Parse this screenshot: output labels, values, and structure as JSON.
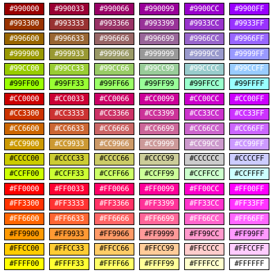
{
  "swatches": [
    [
      "#990000",
      "#990033",
      "#990066",
      "#990099",
      "#9900CC",
      "#9900FF"
    ],
    [
      "#993300",
      "#993333",
      "#993366",
      "#993399",
      "#9933CC",
      "#9933FF"
    ],
    [
      "#996600",
      "#996633",
      "#996666",
      "#996699",
      "#9966CC",
      "#9966FF"
    ],
    [
      "#999900",
      "#999933",
      "#999966",
      "#999999",
      "#9999CC",
      "#9999FF"
    ],
    [
      "#99CC00",
      "#99CC33",
      "#99CC66",
      "#99CC99",
      "#99CCCC",
      "#99CCFF"
    ],
    [
      "#99FF00",
      "#99FF33",
      "#99FF66",
      "#99FF99",
      "#99FFCC",
      "#99FFFF"
    ],
    [
      "#CC0000",
      "#CC0033",
      "#CC0066",
      "#CC0099",
      "#CC00CC",
      "#CC00FF"
    ],
    [
      "#CC3300",
      "#CC3333",
      "#CC3366",
      "#CC3399",
      "#CC33CC",
      "#CC33FF"
    ],
    [
      "#CC6600",
      "#CC6633",
      "#CC6666",
      "#CC6699",
      "#CC66CC",
      "#CC66FF"
    ],
    [
      "#CC9900",
      "#CC9933",
      "#CC9966",
      "#CC9999",
      "#CC99CC",
      "#CC99FF"
    ],
    [
      "#CCCC00",
      "#CCCC33",
      "#CCCC66",
      "#CCCC99",
      "#CCCCCC",
      "#CCCCFF"
    ],
    [
      "#CCFF00",
      "#CCFF33",
      "#CCFF66",
      "#CCFF99",
      "#CCFFCC",
      "#CCFFFF"
    ],
    [
      "#FF0000",
      "#FF0033",
      "#FF0066",
      "#FF0099",
      "#FF00CC",
      "#FF00FF"
    ],
    [
      "#FF3300",
      "#FF3333",
      "#FF3366",
      "#FF3399",
      "#FF33CC",
      "#FF33FF"
    ],
    [
      "#FF6600",
      "#FF6633",
      "#FF6666",
      "#FF6699",
      "#FF66CC",
      "#FF66FF"
    ],
    [
      "#FF9900",
      "#FF9933",
      "#FF9966",
      "#FF9999",
      "#FF99CC",
      "#FF99FF"
    ],
    [
      "#FFCC00",
      "#FFCC33",
      "#FFCC66",
      "#FFCC99",
      "#FFCCCC",
      "#FFCCFF"
    ],
    [
      "#FFFF00",
      "#FFFF33",
      "#FFFF66",
      "#FFFF99",
      "#FFFFCC",
      "#FFFFFF"
    ]
  ],
  "dark_text_rows": [
    5,
    10,
    11,
    15,
    16,
    17
  ]
}
